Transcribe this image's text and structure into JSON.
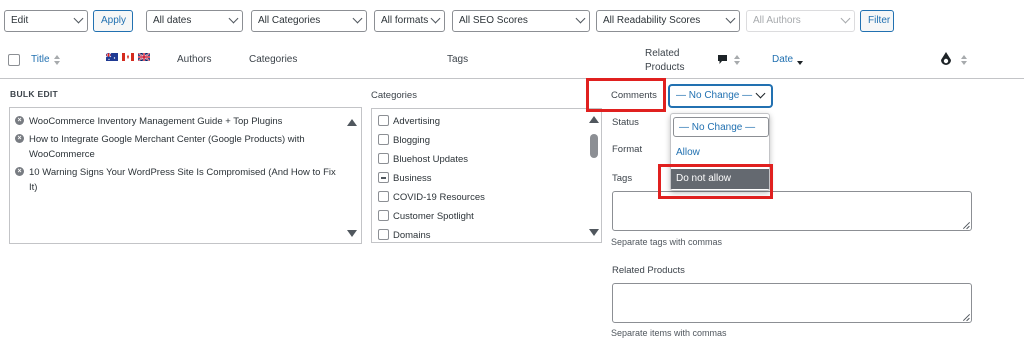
{
  "filters": {
    "bulk_action": "Edit",
    "apply_label": "Apply",
    "dates": "All dates",
    "categories": "All Categories",
    "formats": "All formats",
    "seo": "All SEO Scores",
    "readability": "All Readability Scores",
    "authors": "All Authors",
    "filter_label": "Filter"
  },
  "columns": {
    "title": "Title",
    "authors": "Authors",
    "categories": "Categories",
    "tags": "Tags",
    "related_line1": "Related",
    "related_line2": "Products",
    "date": "Date"
  },
  "icons": {
    "flags": [
      "australia-flag-icon",
      "canada-flag-icon",
      "uk-flag-icon"
    ],
    "comments": "comment-bubble-icon",
    "seo": "seo-drop-icon"
  },
  "bulk_edit": {
    "heading": "BULK EDIT",
    "posts": [
      "WooCommerce Inventory Management Guide + Top Plugins",
      "How to Integrate Google Merchant Center (Google Products) with WooCommerce",
      "10 Warning Signs Your WordPress Site Is Compromised (And How to Fix It)"
    ],
    "categories_label": "Categories",
    "category_items": [
      "Advertising",
      "Blogging",
      "Bluehost Updates",
      "Business",
      "COVID-19 Resources",
      "Customer Spotlight",
      "Domains"
    ],
    "comments_label": "Comments",
    "comments_value": "— No Change —",
    "comments_options": [
      "— No Change —",
      "Allow",
      "Do not allow"
    ],
    "status_label": "Status",
    "format_label": "Format",
    "tags_label": "Tags",
    "tags_help": "Separate tags with commas",
    "related_label": "Related Products",
    "related_help": "Separate items with commas"
  },
  "colors": {
    "accent": "#2271b1",
    "highlight": "#e0201f",
    "active_option": "#646970"
  }
}
